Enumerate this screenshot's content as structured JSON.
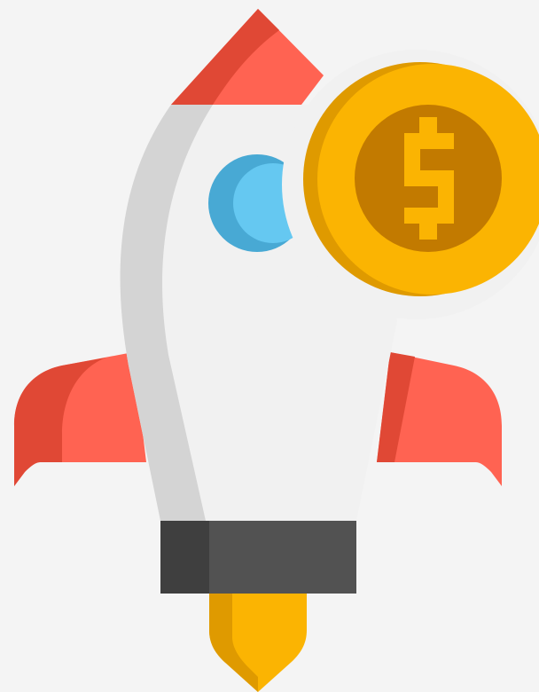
{
  "illustration": {
    "subject": "rocket-with-dollar-coin",
    "colors": {
      "background": "#f4f4f4",
      "fin_light": "#ff6352",
      "fin_dark": "#e04835",
      "body_light": "#f1f1f1",
      "body_shade": "#d4d4d4",
      "window_light": "#65c8f1",
      "window_dark": "#48a9d4",
      "nozzle_dark": "#3f3f3f",
      "nozzle_light": "#525252",
      "flame_light": "#fbb402",
      "flame_dark": "#df9a00",
      "coin_outer": "#fbb402",
      "coin_rim": "#df9a00",
      "coin_inner": "#c27a00",
      "dollar_sign": "#fbb402"
    },
    "icons": [
      "rocket-icon",
      "dollar-coin-icon"
    ]
  }
}
